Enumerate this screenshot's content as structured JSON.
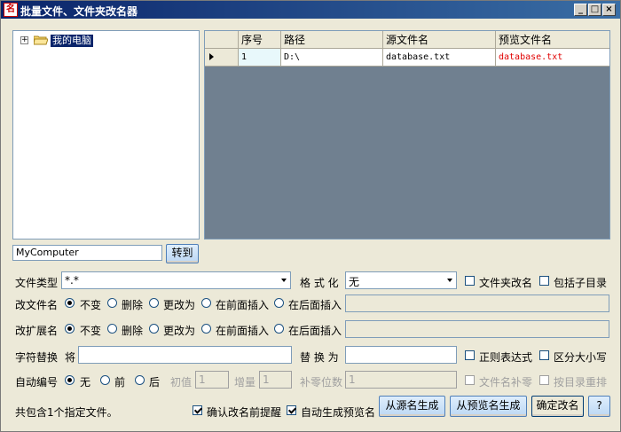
{
  "window": {
    "title": "批量文件、文件夹改名器",
    "min": "_",
    "max": "□",
    "close": "×",
    "icon_glyph": "名"
  },
  "tree": {
    "expander": "+",
    "root_label": "我的电脑"
  },
  "grid": {
    "columns": [
      "序号",
      "路径",
      "源文件名",
      "预览文件名"
    ],
    "rows": [
      {
        "index": "1",
        "path": "D:\\",
        "source": "database.txt",
        "preview": "database.txt"
      }
    ],
    "preview_color": "#e00000"
  },
  "path_input": {
    "value": "MyComputer"
  },
  "goto_button": "转到",
  "file_type": {
    "label": "文件类型",
    "value": "*.*"
  },
  "format": {
    "label": "格 式 化",
    "value": "无"
  },
  "folder_rename": {
    "label": "文件夹改名",
    "checked": false
  },
  "include_subdir": {
    "label": "包括子目录",
    "checked": false
  },
  "rename_file": {
    "label": "改文件名",
    "options": [
      "不变",
      "删除",
      "更改为",
      "在前面插入",
      "在后面插入"
    ],
    "selected": 0
  },
  "rename_ext": {
    "label": "改扩展名",
    "options": [
      "不变",
      "删除",
      "更改为",
      "在前面插入",
      "在后面插入"
    ],
    "selected": 0
  },
  "replace": {
    "label": "字符替换",
    "from_label": "将",
    "to_label": "替 换 为"
  },
  "regex": {
    "label": "正则表达式",
    "checked": false
  },
  "case_sensitive": {
    "label": "区分大小写",
    "checked": false
  },
  "auto_number": {
    "label": "自动编号",
    "options": [
      "无",
      "前",
      "后"
    ],
    "selected": 0,
    "start_label": "初值",
    "start_value": "1",
    "step_label": "增量",
    "step_value": "1",
    "pad_label": "补零位数",
    "pad_value": "1"
  },
  "filename_pad": {
    "label": "文件名补零",
    "checked": false
  },
  "by_dir_reorder": {
    "label": "按目录重排",
    "checked": false
  },
  "status": "共包含1个指定文件。",
  "confirm_prompt": {
    "label": "确认改名前提醒",
    "checked": true
  },
  "auto_preview": {
    "label": "自动生成预览名",
    "checked": true
  },
  "buttons": {
    "from_source": "从源名生成",
    "from_preview": "从预览名生成",
    "confirm": "确定改名",
    "help": "?"
  }
}
